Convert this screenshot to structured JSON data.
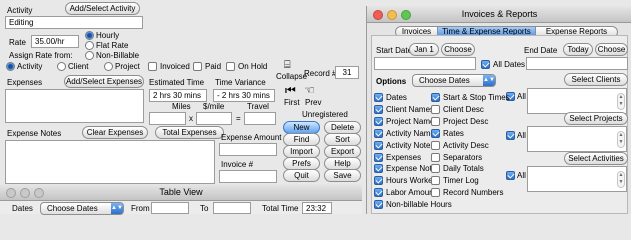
{
  "main": {
    "activity_label": "Activity",
    "add_select_activity": "Add/Select Activity",
    "activity_value": "Editing",
    "rate_label": "Rate",
    "rate_value": "35.00/hr",
    "rate_options": [
      "Hourly",
      "Flat Rate",
      "Non-Billable"
    ],
    "assign_rate_label": "Assign Rate from:",
    "assign_options": [
      "Activity",
      "Client",
      "Project"
    ],
    "status_checks": [
      "Invoiced",
      "Paid",
      "On Hold"
    ],
    "record_label": "Record #",
    "record_value": "31",
    "expenses_label": "Expenses",
    "add_select_expenses": "Add/Select Expenses",
    "estimated_time_label": "Estimated Time",
    "estimated_time_value": "2 hrs 30 mins",
    "time_variance_label": "Time Variance",
    "time_variance_value": "- 2 hrs 30 mins",
    "miles_label": "Miles",
    "per_mile_label": "$/mile",
    "travel_label": "Travel",
    "times_symbol": "x",
    "equals_symbol": "=",
    "collapse_label": "Collapse",
    "first_label": "First",
    "prev_label": "Prev",
    "unregistered_label": "Unregistered",
    "expense_notes_label": "Expense Notes",
    "clear_expenses": "Clear Expenses",
    "total_expenses": "Total Expenses",
    "expense_amount_label": "Expense Amount",
    "invoice_label": "Invoice #",
    "buttons": [
      "New",
      "Delete",
      "Find",
      "Sort",
      "Import",
      "Export",
      "Prefs",
      "Help",
      "Quit",
      "Save"
    ]
  },
  "table_view": {
    "title": "Table View",
    "dates_label": "Dates",
    "dates_popup": "Choose Dates",
    "from_label": "From",
    "to_label": "To",
    "total_time_label": "Total Time",
    "total_time_value": "23:32"
  },
  "reports": {
    "title": "Invoices & Reports",
    "tabs": [
      "Invoices",
      "Time & Expense Reports",
      "Expense Reports"
    ],
    "active_tab": 1,
    "start_date_label": "Start Date",
    "jan1_button": "Jan 1",
    "choose_button": "Choose",
    "end_date_label": "End Date",
    "today_button": "Today",
    "choose_button2": "Choose",
    "all_dates_label": "All Dates",
    "options_label": "Options",
    "options_popup": "Choose Dates",
    "select_clients": "Select Clients",
    "select_projects": "Select Projects",
    "select_activities": "Select Activities",
    "all_label": "All",
    "left_checks": [
      {
        "label": "Dates",
        "checked": true
      },
      {
        "label": "Client Names",
        "checked": true
      },
      {
        "label": "Project Names",
        "checked": true
      },
      {
        "label": "Activity Names",
        "checked": true
      },
      {
        "label": "Activity Notes",
        "checked": true
      },
      {
        "label": "Expenses",
        "checked": true
      },
      {
        "label": "Expense Notes",
        "checked": true
      },
      {
        "label": "Hours Worked",
        "checked": true
      },
      {
        "label": "Labor Amounts",
        "checked": true
      },
      {
        "label": "Non-billable Hours",
        "checked": true
      }
    ],
    "mid_checks": [
      {
        "label": "Start & Stop Times",
        "checked": true
      },
      {
        "label": "Client Desc",
        "checked": false
      },
      {
        "label": "Project Desc",
        "checked": false
      },
      {
        "label": "Rates",
        "checked": true
      },
      {
        "label": "Activity Desc",
        "checked": false
      },
      {
        "label": "Separators",
        "checked": false
      },
      {
        "label": "Daily Totals",
        "checked": false
      },
      {
        "label": "Timer Log",
        "checked": false
      },
      {
        "label": "Record Numbers",
        "checked": false
      }
    ]
  },
  "colors": {
    "accent": "#5ea3f2",
    "window_bg": "#e8e8e8",
    "traffic_red": "#ee5d57",
    "traffic_yellow": "#f5bd4f",
    "traffic_green": "#62c655"
  }
}
